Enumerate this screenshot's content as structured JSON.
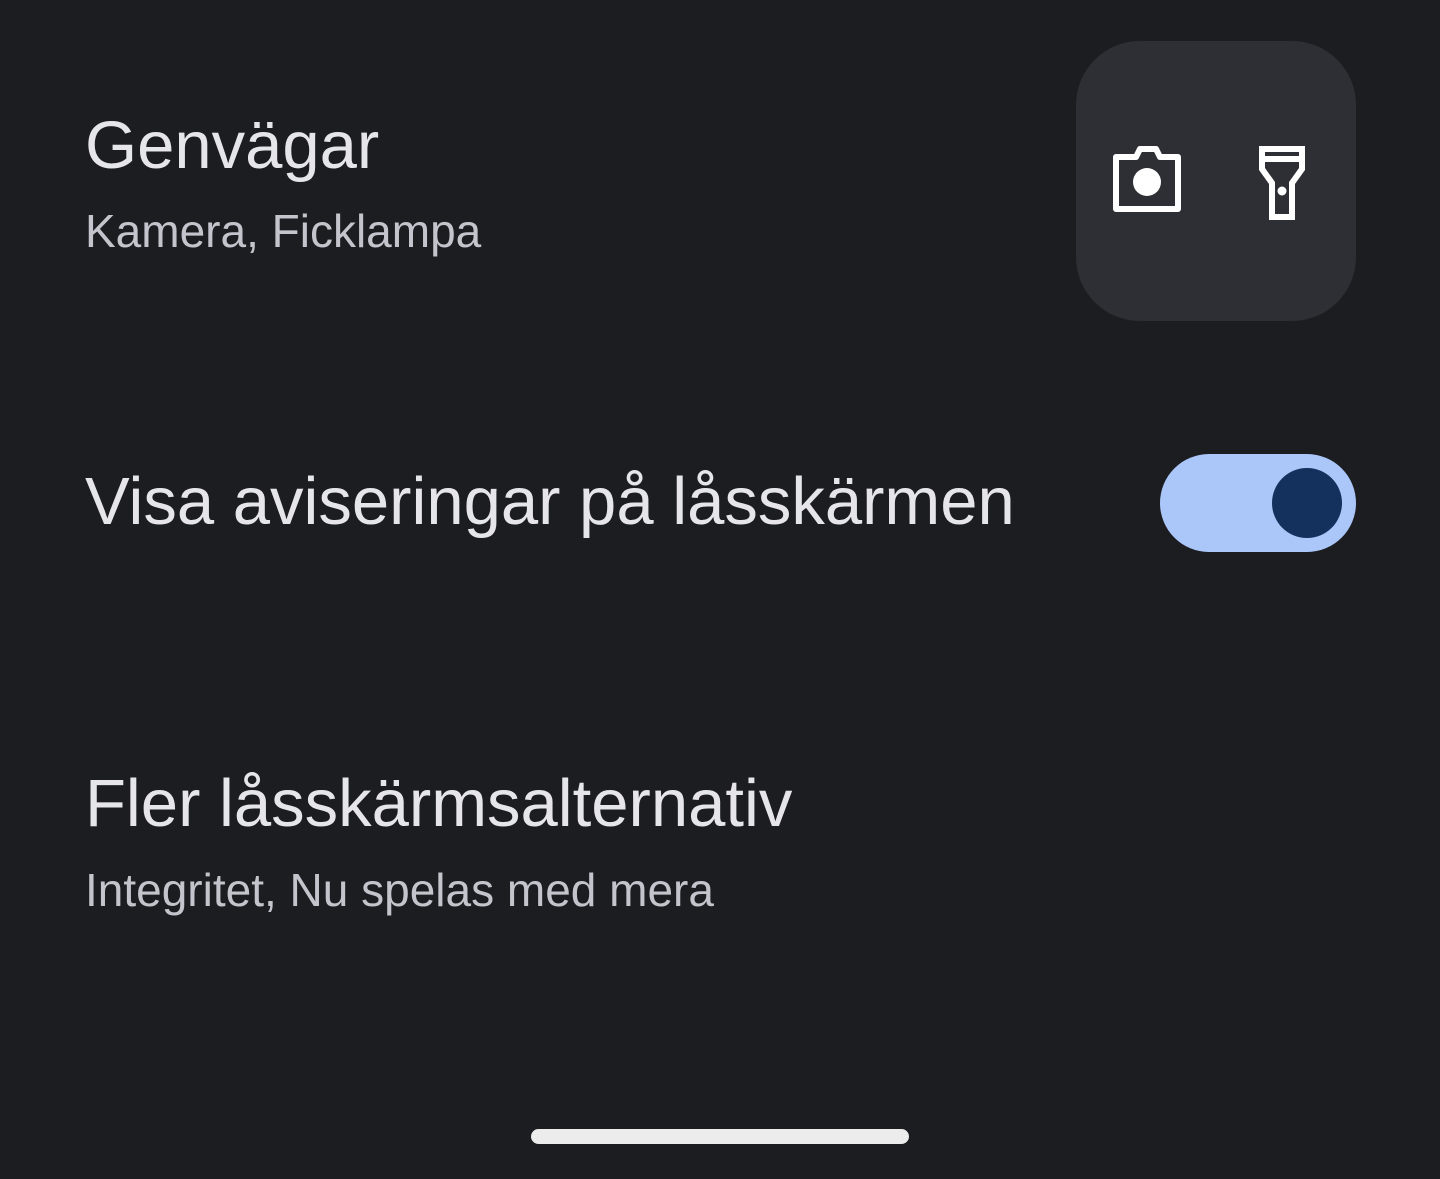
{
  "shortcuts": {
    "title": "Genvägar",
    "subtitle": "Kamera, Ficklampa",
    "icons": [
      "camera-icon",
      "flashlight-icon"
    ]
  },
  "notifications": {
    "title": "Visa aviseringar på låsskärmen",
    "toggle_on": true
  },
  "more_options": {
    "title": "Fler låsskärmsalternativ",
    "subtitle": "Integritet, Nu spelas med mera"
  },
  "colors": {
    "background": "#1c1d21",
    "shortcut_box": "#2e2f35",
    "toggle_track_on": "#abc7fa",
    "toggle_thumb_on": "#14305c",
    "title_text": "#e6e6ea",
    "subtitle_text": "#c3c4cc",
    "icon": "#ffffff"
  }
}
